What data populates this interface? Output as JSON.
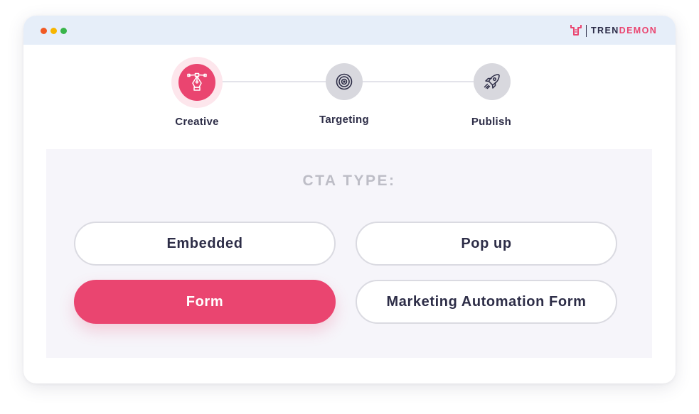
{
  "window": {
    "traffic_lights": {
      "close": "#f15a24",
      "minimize": "#f7b500",
      "maximize": "#39b54a"
    },
    "brand": {
      "part1": "TREN",
      "part2": "DEMON",
      "dark_color": "#2c2c48",
      "accent_color": "#ea4570",
      "icon": "trendemon-logo-icon"
    }
  },
  "stepper": {
    "steps": [
      {
        "label": "Creative",
        "icon": "pen-tool-icon",
        "state": "active"
      },
      {
        "label": "Targeting",
        "icon": "target-icon",
        "state": "inactive"
      },
      {
        "label": "Publish",
        "icon": "rocket-icon",
        "state": "inactive"
      }
    ]
  },
  "cta": {
    "title": "CTA TYPE:",
    "options": [
      {
        "label": "Embedded",
        "selected": false
      },
      {
        "label": "Pop up",
        "selected": false
      },
      {
        "label": "Form",
        "selected": true
      },
      {
        "label": "Marketing Automation Form",
        "selected": false
      }
    ]
  },
  "colors": {
    "accent": "#ea4570",
    "text_dark": "#2d2d47",
    "muted": "#bdbdc6",
    "panel_bg": "#f6f5fa",
    "titlebar_bg": "#e6eef9"
  }
}
